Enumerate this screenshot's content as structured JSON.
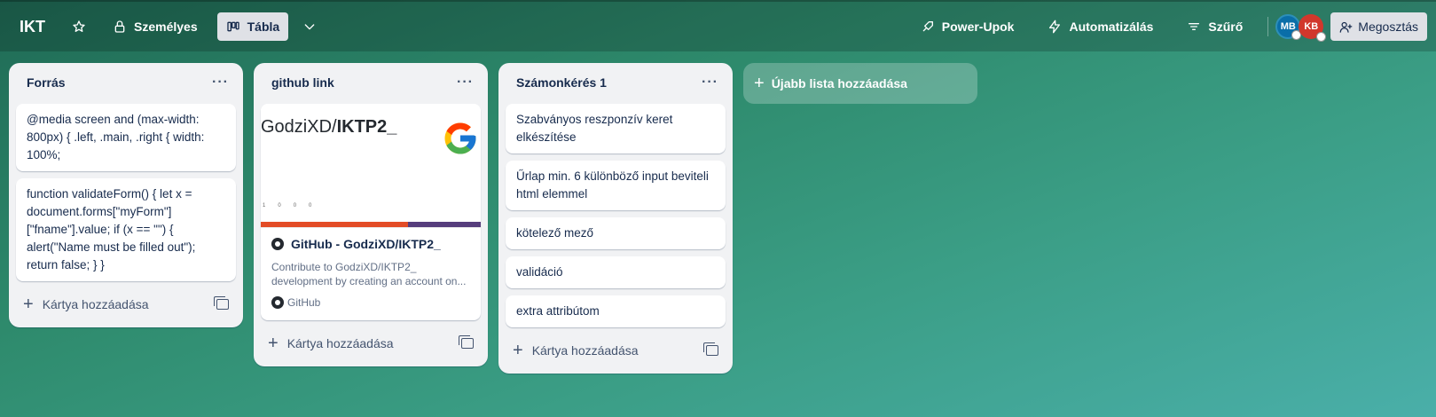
{
  "board": {
    "name": "IKT",
    "visibility_label": "Személyes",
    "view_label": "Tábla"
  },
  "header": {
    "power_ups_label": "Power-Upok",
    "automation_label": "Automatizálás",
    "filter_label": "Szűrő",
    "share_label": "Megosztás",
    "members": [
      {
        "initials": "MB",
        "color": "#0a6ea8"
      },
      {
        "initials": "KB",
        "color": "#d1372c"
      }
    ]
  },
  "lists": [
    {
      "title": "Forrás",
      "cards": [
        "@media screen and (max-width: 800px) { .left, .main, .right { width: 100%;",
        "function validateForm() { let x = document.forms[\"myForm\"][\"fname\"].value; if (x == \"\") { alert(\"Name must be filled out\"); return false; } }"
      ],
      "add_card_label": "Kártya hozzáadása"
    },
    {
      "title": "github link",
      "link_card": {
        "preview_owner": "GodziXD/",
        "preview_repo": "IKTP2_",
        "preview_stats": [
          "1",
          "0",
          "0",
          "0"
        ],
        "title": "GitHub - GodziXD/IKTP2_",
        "description": "Contribute to GodziXD/IKTP2_ development by creating an account on...",
        "source": "GitHub"
      },
      "add_card_label": "Kártya hozzáadása"
    },
    {
      "title": "Számonkérés 1",
      "cards": [
        "Szabványos reszponzív keret elkészítése",
        "Űrlap min. 6 különböző input beviteli html elemmel",
        "kötelező mező",
        "validáció",
        "extra attribútom"
      ],
      "add_card_label": "Kártya hozzáadása"
    }
  ],
  "add_list_label": "Újabb lista hozzáadása",
  "colors": {
    "language_bar": [
      "#e34c26",
      "#563d7c"
    ]
  }
}
